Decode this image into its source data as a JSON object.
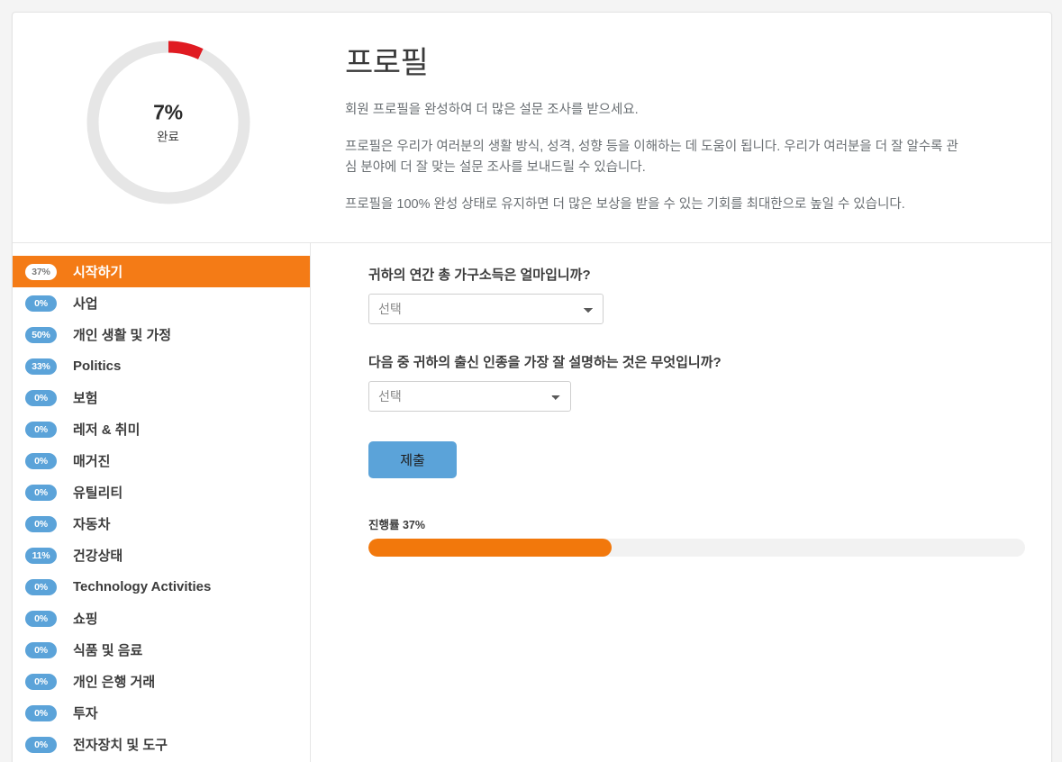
{
  "hero": {
    "donut": {
      "percent_text": "7%",
      "percent_value": 7,
      "label": "완료",
      "arc_color": "#e01b22",
      "track_color": "#e6e6e6"
    },
    "title": "프로필",
    "paragraphs": [
      "회원 프로필을 완성하여 더 많은 설문 조사를 받으세요.",
      "프로필은 우리가 여러분의 생활 방식, 성격, 성향 등을 이해하는 데 도움이 됩니다. 우리가 여러분을 더 잘 알수록 관심 분야에 더 잘 맞는 설문 조사를 보내드릴 수 있습니다.",
      "프로필을 100% 완성 상태로 유지하면 더 많은 보상을 받을 수 있는 기회를 최대한으로 높일 수 있습니다."
    ]
  },
  "sidebar": {
    "active_color": "#f47b16",
    "badge_color": "#5ba3d9",
    "items": [
      {
        "badge": "37%",
        "label": "시작하기",
        "active": true
      },
      {
        "badge": "0%",
        "label": "사업",
        "active": false
      },
      {
        "badge": "50%",
        "label": "개인 생활 및 가정",
        "active": false
      },
      {
        "badge": "33%",
        "label": "Politics",
        "active": false
      },
      {
        "badge": "0%",
        "label": "보험",
        "active": false
      },
      {
        "badge": "0%",
        "label": "레저 & 취미",
        "active": false
      },
      {
        "badge": "0%",
        "label": "매거진",
        "active": false
      },
      {
        "badge": "0%",
        "label": "유틸리티",
        "active": false
      },
      {
        "badge": "0%",
        "label": "자동차",
        "active": false
      },
      {
        "badge": "11%",
        "label": "건강상태",
        "active": false
      },
      {
        "badge": "0%",
        "label": "Technology Activities",
        "active": false
      },
      {
        "badge": "0%",
        "label": "쇼핑",
        "active": false
      },
      {
        "badge": "0%",
        "label": "식품 및 음료",
        "active": false
      },
      {
        "badge": "0%",
        "label": "개인 은행 거래",
        "active": false
      },
      {
        "badge": "0%",
        "label": "투자",
        "active": false
      },
      {
        "badge": "0%",
        "label": "전자장치 및 도구",
        "active": false
      }
    ]
  },
  "form": {
    "question1": "귀하의 연간 총 가구소득은 얼마입니까?",
    "select1_value": "선택",
    "question2": "다음 중 귀하의 출신 인종을 가장 잘 설명하는 것은 무엇입니까?",
    "select2_value": "선택",
    "submit_label": "제출",
    "progress_label": "진행률 37%",
    "progress_percent": 37,
    "progress_fill_color": "#f2780c"
  }
}
